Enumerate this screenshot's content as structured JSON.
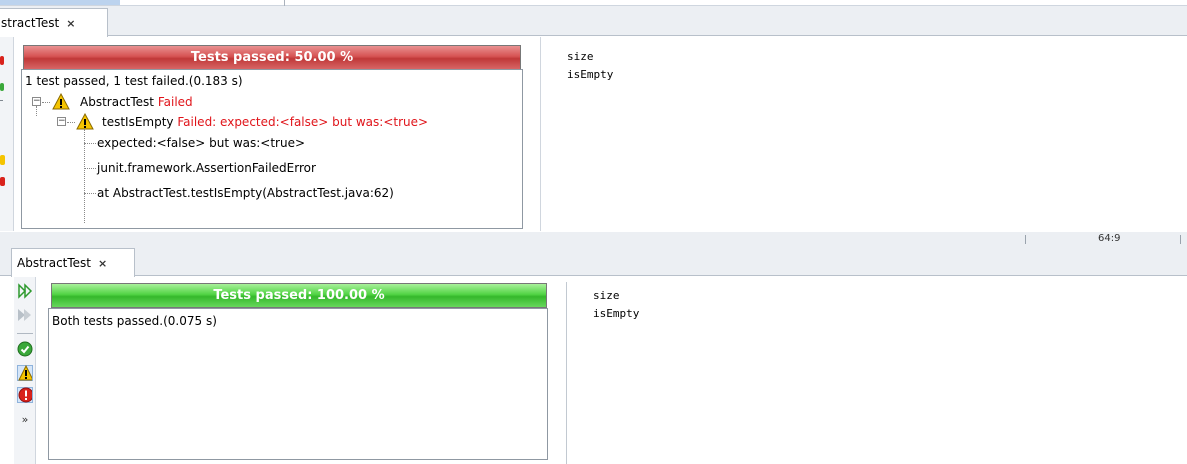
{
  "top_panel": {
    "tab": {
      "label": "stractTest",
      "close_glyph": "×"
    },
    "progress": {
      "label": "Tests passed: 50.00 %",
      "percent": 50.0,
      "color": "#d65353"
    },
    "summary": "1 test passed, 1 test failed.(0.183 s)",
    "tree": {
      "suite": {
        "name": "AbstractTest",
        "status": "Failed"
      },
      "test": {
        "name": "testIsEmpty",
        "status": "Failed: expected:<false> but was:<true>"
      },
      "details": [
        "expected:<false> but was:<true>",
        "junit.framework.AssertionFailedError",
        "at AbstractTest.testIsEmpty(AbstractTest.java:62)"
      ]
    },
    "output": [
      "size",
      "isEmpty"
    ]
  },
  "status_bar": {
    "position": "64:9"
  },
  "bottom_panel": {
    "tab": {
      "label": "AbstractTest",
      "close_glyph": "×"
    },
    "progress": {
      "label": "Tests passed: 100.00 %",
      "percent": 100.0,
      "color": "#35b82b"
    },
    "summary": "Both tests passed.(0.075 s)",
    "output": [
      "size",
      "isEmpty"
    ],
    "toolbar": {
      "icons": [
        "rerun-icon",
        "rerun-failed-icon",
        "show-passed-icon",
        "show-warnings-icon",
        "show-errors-icon",
        "more-icon"
      ],
      "more_glyph": "»"
    }
  },
  "colors": {
    "fail_text": "#e0141a",
    "warning": "#f5c400",
    "error": "#d9221c",
    "pass": "#3aa83a",
    "tab_bg": "#eceff3"
  }
}
